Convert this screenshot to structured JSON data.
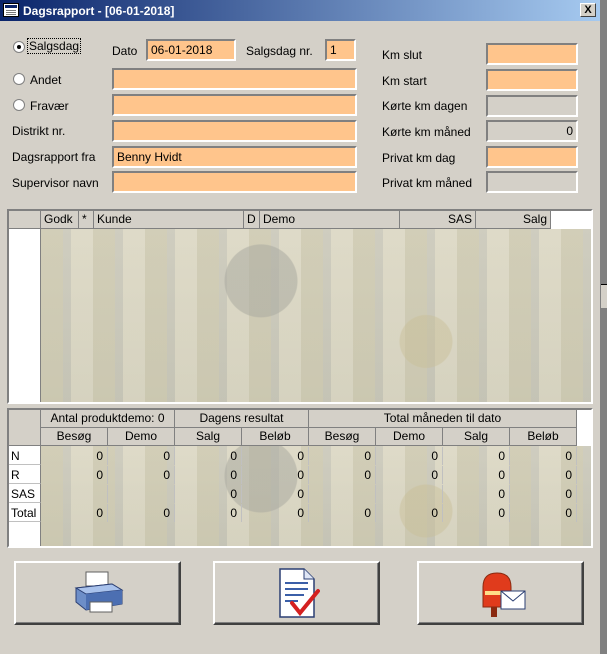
{
  "window": {
    "title": "Dagsrapport - [06-01-2018]",
    "close_label": "X"
  },
  "header_form": {
    "radio_salgsdag": "Salgsdag",
    "radio_andet": "Andet",
    "radio_fravaer": "Fravær",
    "distrikt_label": "Distrikt nr.",
    "dagsrapport_fra_label": "Dagsrapport fra",
    "dagsrapport_fra_value": "Benny Hvidt",
    "supervisor_label": "Supervisor navn",
    "dato_label": "Dato",
    "dato_value": "06-01-2018",
    "salgsdag_nr_label": "Salgsdag nr.",
    "salgsdag_nr_value": "1",
    "km_slut": "Km slut",
    "km_start": "Km start",
    "korte_km_dagen": "Kørte km dagen",
    "korte_km_maned": "Kørte km måned",
    "korte_km_maned_value": "0",
    "privat_km_dag": "Privat km dag",
    "privat_km_maned": "Privat km måned"
  },
  "visit_grid": {
    "columns": [
      "Godk",
      "*",
      "Kunde",
      "D",
      "Demo",
      "SAS",
      "Salg"
    ]
  },
  "summary_grid": {
    "group_antal": "Antal produktdemo: 0",
    "group_dagens": "Dagens resultat",
    "group_total": "Total måneden til dato",
    "subcols": [
      "Besøg",
      "Demo",
      "Salg",
      "Beløb",
      "Besøg",
      "Demo",
      "Salg",
      "Beløb"
    ],
    "rows": [
      {
        "label": "N",
        "values": [
          "0",
          "0",
          "0",
          "0",
          "0",
          "0",
          "0",
          "0"
        ]
      },
      {
        "label": "R",
        "values": [
          "0",
          "0",
          "0",
          "0",
          "0",
          "0",
          "0",
          "0"
        ]
      },
      {
        "label": "SAS",
        "values": [
          "",
          "",
          "0",
          "0",
          "",
          "",
          "0",
          "0"
        ]
      },
      {
        "label": "Total",
        "values": [
          "0",
          "0",
          "0",
          "0",
          "0",
          "0",
          "0",
          "0"
        ]
      }
    ]
  },
  "buttons": {
    "print_icon": "printer-icon",
    "approve_icon": "checked-document-icon",
    "mail_icon": "mailbox-icon"
  },
  "colors": {
    "field": "#ffc58c",
    "field_gray": "#d4d0c8",
    "window": "#d4d0c8",
    "title_start": "#0a246a",
    "title_end": "#a6caf0"
  }
}
